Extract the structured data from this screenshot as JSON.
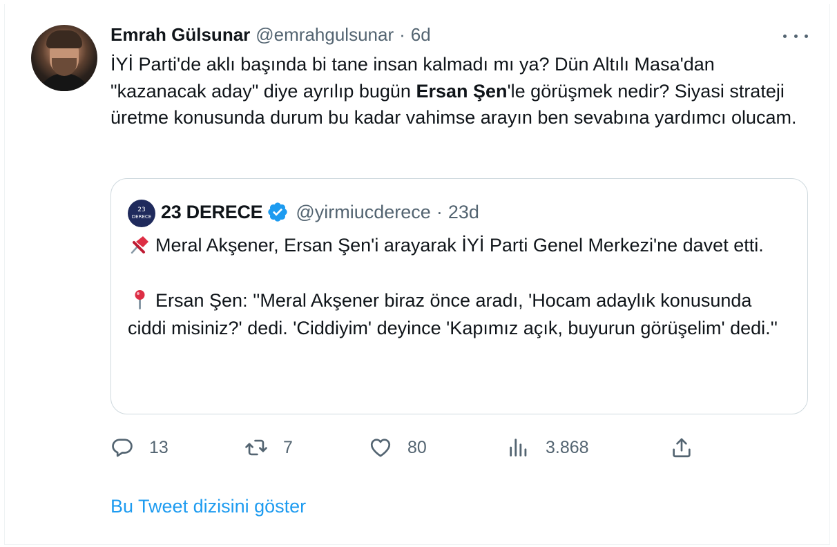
{
  "tweet": {
    "author_name": "Emrah Gülsunar",
    "author_handle": "@emrahgulsunar",
    "separator": "·",
    "time": "6d",
    "text_part1": "İYİ Parti'de aklı başında bi tane insan kalmadı mı ya? Dün Altılı Masa'dan \"kazanacak aday\" diye ayrılıp bugün ",
    "text_bold": "Ersan Şen",
    "text_part2": "'le görüşmek nedir? Siyasi strateji üretme konusunda durum bu kadar vahimse arayın ben sevabına yardımcı olucam."
  },
  "quote": {
    "avatar_text_top": "23",
    "avatar_text_bottom": "DERECE",
    "author_name": "23 DERECE",
    "author_handle": "@yirmiucderece",
    "separator": "·",
    "time": "23d",
    "line1": "Meral Akşener, Ersan Şen'i arayarak İYİ Parti Genel Merkezi'ne davet etti.",
    "line2": "Ersan Şen: ''Meral Akşener biraz önce aradı, 'Hocam adaylık konusunda ciddi misiniz?' dedi. 'Ciddiyim' deyince 'Kapımız açık, buyurun görüşelim' dedi.''"
  },
  "actions": {
    "replies": "13",
    "retweets": "7",
    "likes": "80",
    "views": "3.868"
  },
  "show_thread": "Bu Tweet dizisini göster",
  "colors": {
    "text": "#0f1419",
    "secondary": "#536471",
    "link": "#1d9bf0",
    "verified": "#1d9bf0",
    "border": "#cfd9de"
  }
}
